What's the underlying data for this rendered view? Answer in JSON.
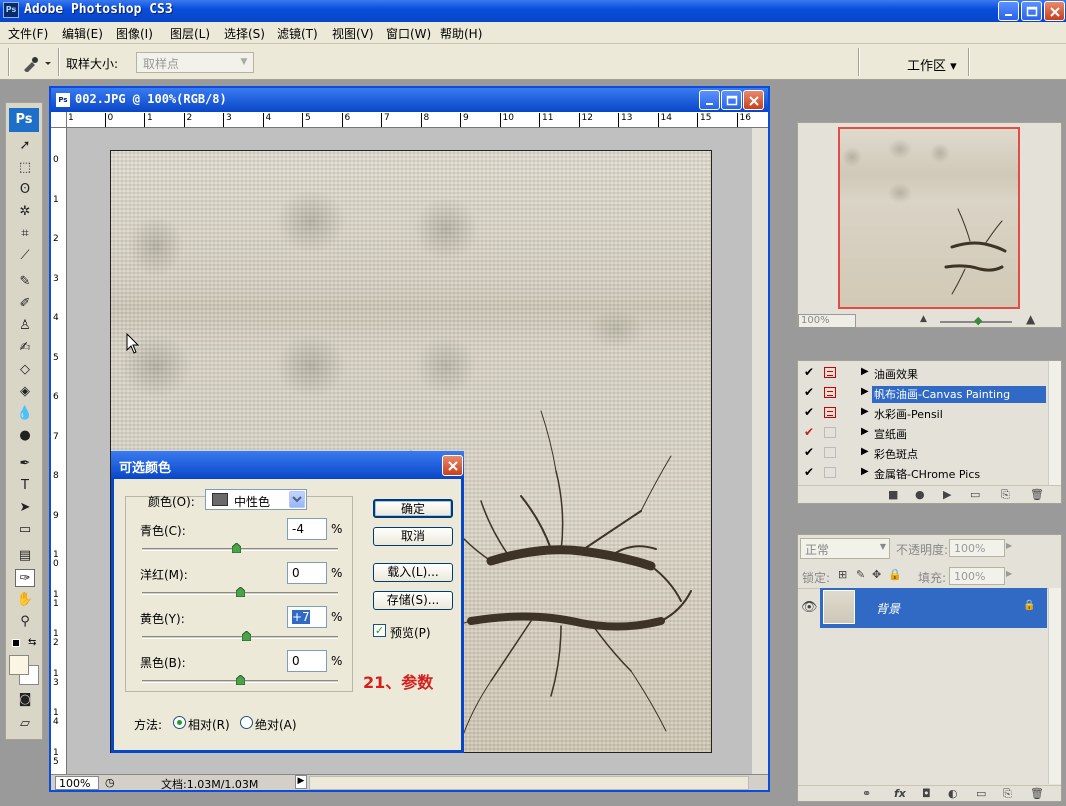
{
  "app": {
    "title": "Adobe Photoshop CS3"
  },
  "menu": [
    "文件(F)",
    "编辑(E)",
    "图像(I)",
    "图层(L)",
    "选择(S)",
    "滤镜(T)",
    "视图(V)",
    "窗口(W)",
    "帮助(H)"
  ],
  "options": {
    "sample_size_label": "取样大小:",
    "sample_size_value": "取样点",
    "workspace_label": "工作区 ▾"
  },
  "document": {
    "title": "002.JPG @ 100%(RGB/8)",
    "zoom": "100%",
    "doc_size": "文档:1.03M/1.03M",
    "ruler_h": [
      "1",
      "0",
      "1",
      "2",
      "3",
      "4",
      "5",
      "6",
      "7",
      "8",
      "9",
      "10",
      "11",
      "12",
      "13",
      "14",
      "15",
      "16"
    ],
    "ruler_v": [
      "0",
      "1",
      "2",
      "3",
      "4",
      "5",
      "6",
      "7",
      "8",
      "9",
      "10",
      "11",
      "12",
      "13",
      "14",
      "15"
    ]
  },
  "dialog": {
    "title": "可选颜色",
    "colors_label": "颜色(O):",
    "colors_value": "中性色",
    "cyan_label": "青色(C):",
    "cyan_value": "-4",
    "magenta_label": "洋红(M):",
    "magenta_value": "0",
    "yellow_label": "黄色(Y):",
    "yellow_value": "+7",
    "black_label": "黑色(B):",
    "black_value": "0",
    "percent": "%",
    "ok": "确定",
    "cancel": "取消",
    "load": "载入(L)...",
    "save": "存储(S)...",
    "preview": "预览(P)",
    "method_label": "方法:",
    "relative": "相对(R)",
    "absolute": "绝对(A)",
    "annotation": "21、参数",
    "slider_levels": {
      "cyan": -4,
      "magenta": 0,
      "yellow": 7,
      "black": 0
    }
  },
  "navigator": {
    "zoom": "100%"
  },
  "actions": [
    {
      "name": "油画效果",
      "checked": true,
      "dialog": true
    },
    {
      "name": "帆布油画-Canvas Painting",
      "checked": true,
      "dialog": true,
      "selected": true
    },
    {
      "name": "水彩画-Pensil",
      "checked": true,
      "dialog": true
    },
    {
      "name": "宣纸画",
      "checked": true,
      "dialog": false
    },
    {
      "name": "彩色斑点",
      "checked": true,
      "dialog": false
    },
    {
      "name": "金属铬-CHrome Pics",
      "checked": true,
      "dialog": false
    }
  ],
  "layers": {
    "blend_mode": "正常",
    "opacity_label": "不透明度:",
    "opacity_value": "100%",
    "lock_label": "锁定:",
    "fill_label": "填充:",
    "fill_value": "100%",
    "layer_name": "背景"
  },
  "colors": {
    "accent": "#0a4ddc",
    "selection": "#316ac5",
    "annotation": "#d4201c"
  }
}
